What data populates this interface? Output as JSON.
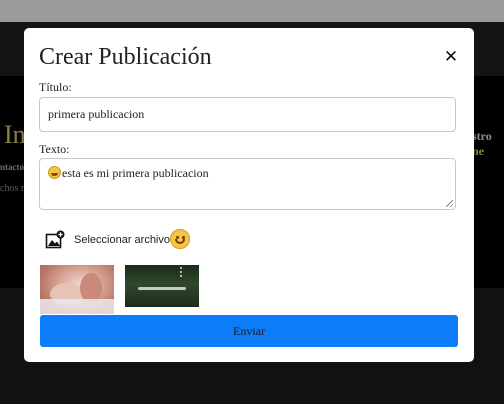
{
  "background": {
    "heading_fragment": "In",
    "right_fragment_prefix": "stro ",
    "right_fragment_accent": "ne",
    "sub_fragment_1": "ntactos",
    "sub_fragment_2": "chos re"
  },
  "modal": {
    "title": "Crear Publicación",
    "close_symbol": "✕",
    "title_label": "Título:",
    "title_value": "primera publicacion",
    "text_label": "Texto:",
    "text_value": "esta es mi primera publicacion",
    "file_label": "Seleccionar archivo",
    "submit_label": "Enviar",
    "accent_color": "#0d7cf8"
  },
  "icons": {
    "file": "image-add-icon",
    "emoji": "smiley-emoji-icon",
    "close": "close-icon"
  }
}
